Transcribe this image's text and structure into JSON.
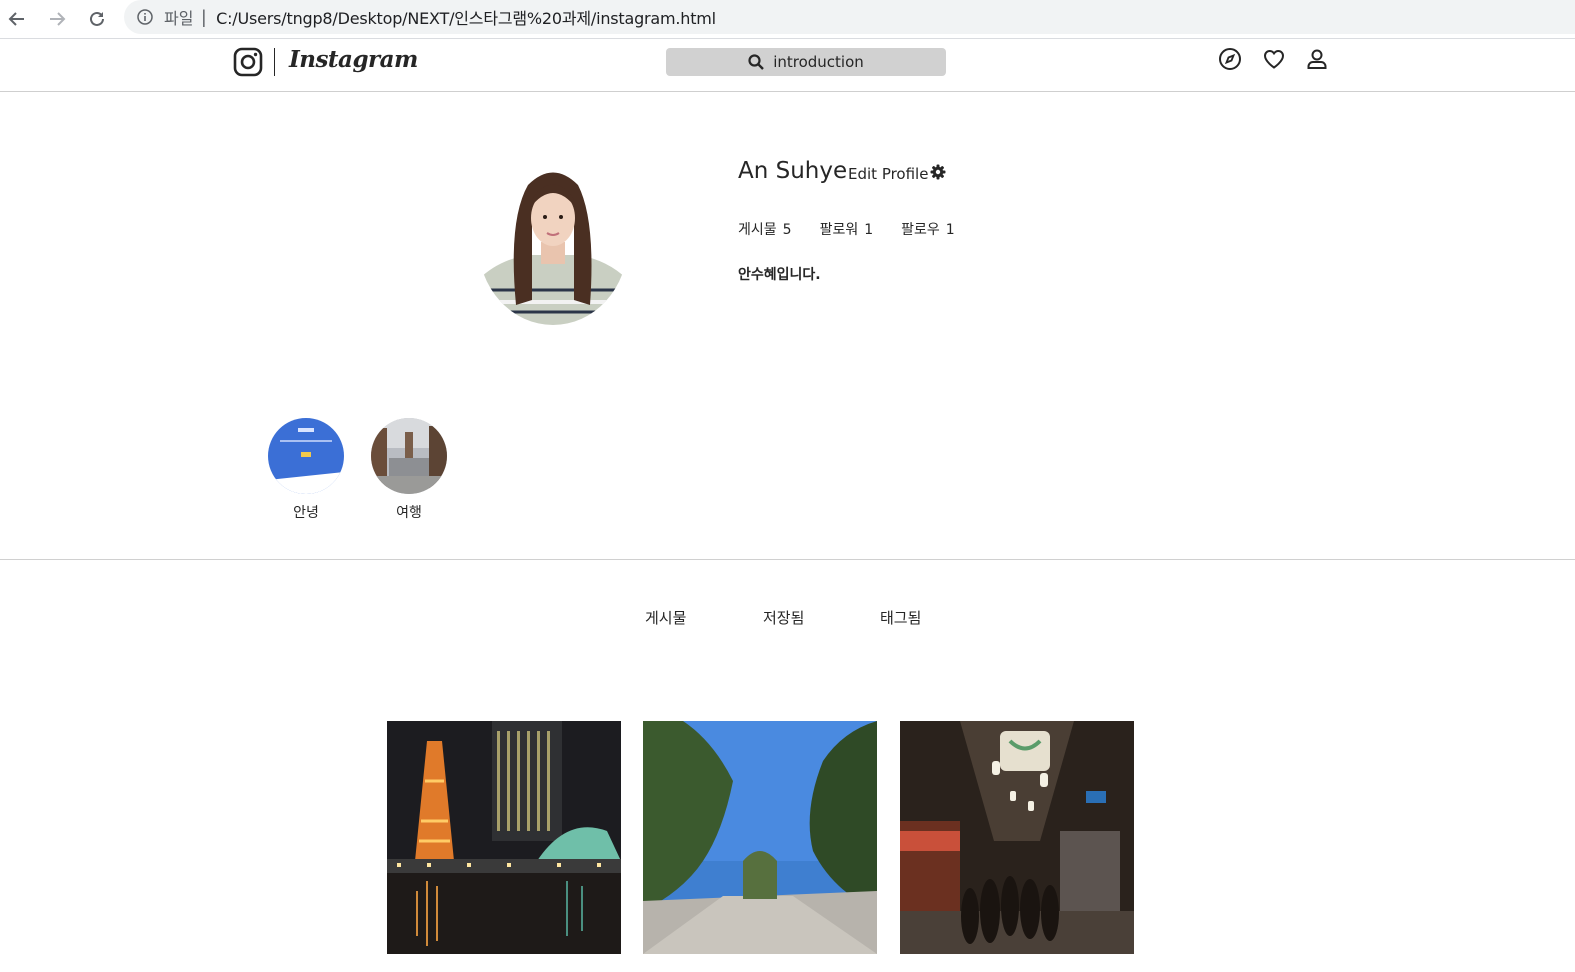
{
  "browser": {
    "url_scheme": "파일",
    "url": "C:/Users/tngp8/Desktop/NEXT/인스타그램%20과제/instagram.html"
  },
  "header": {
    "wordmark": "Instagram",
    "search_text": "introduction",
    "icons": [
      "compass-icon",
      "heart-icon",
      "user-icon"
    ]
  },
  "profile": {
    "username": "An Suhye",
    "edit_profile": "Edit Profile",
    "stats": [
      {
        "label": "게시물",
        "value": "5"
      },
      {
        "label": "팔로워",
        "value": "1"
      },
      {
        "label": "팔로우",
        "value": "1"
      }
    ],
    "bio": "안수혜입니다."
  },
  "highlights": [
    {
      "label": "안녕"
    },
    {
      "label": "여행"
    }
  ],
  "tabs": [
    {
      "label": "게시물"
    },
    {
      "label": "저장됨"
    },
    {
      "label": "태그됨"
    }
  ],
  "colors": {
    "search_bg": "#d1d1d1",
    "text": "#262626",
    "omnibox_bg": "#f1f3f4"
  }
}
